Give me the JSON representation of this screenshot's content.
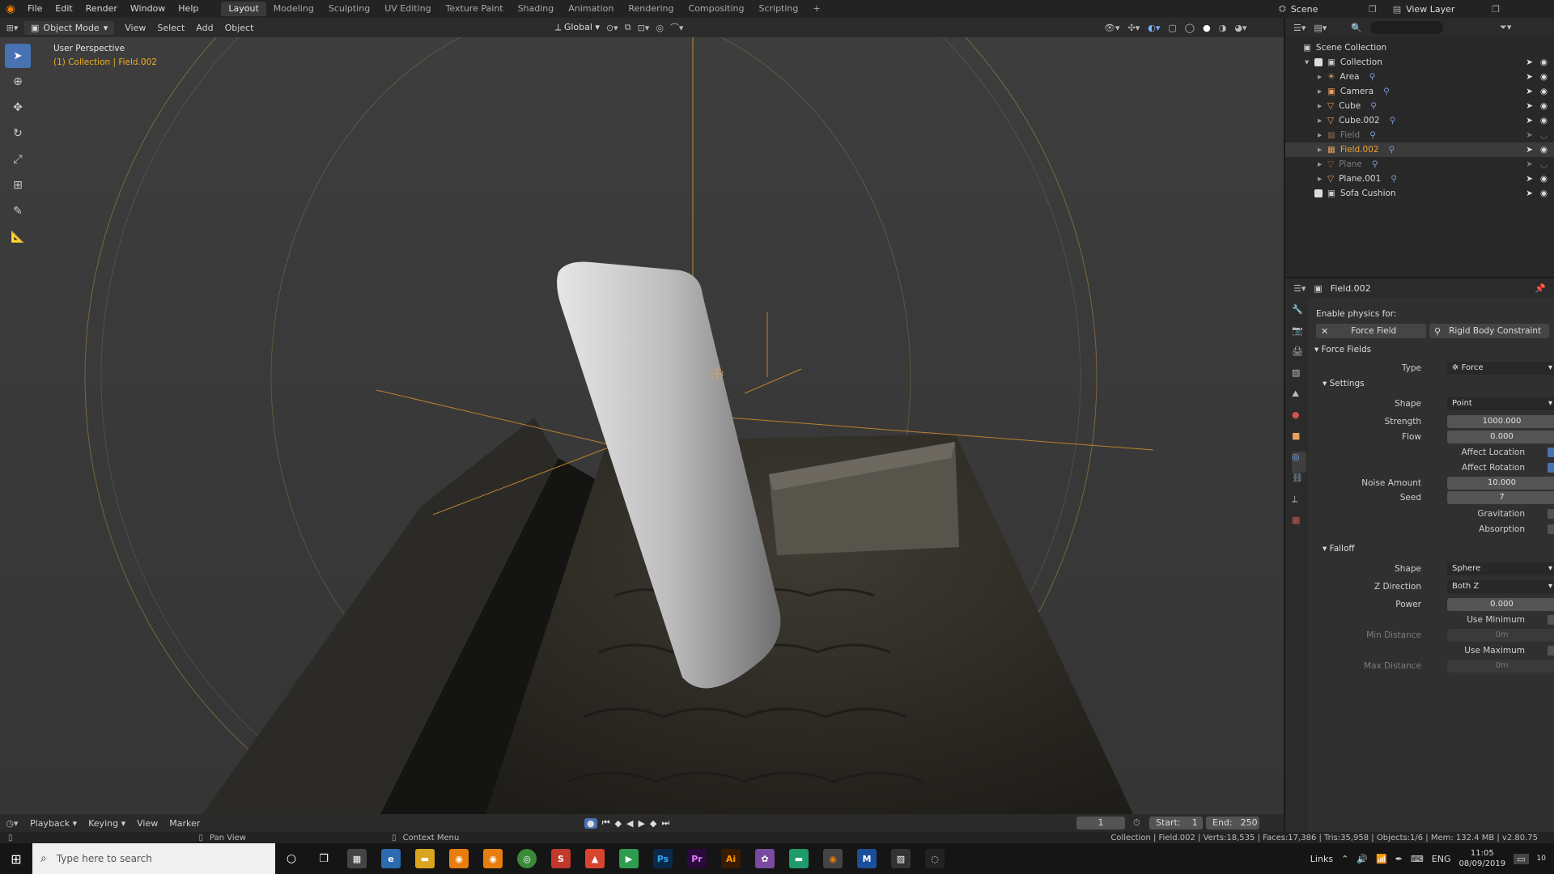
{
  "menu": {
    "items": [
      "File",
      "Edit",
      "Render",
      "Window",
      "Help"
    ]
  },
  "workspaces": {
    "active": "Layout",
    "tabs": [
      "Layout",
      "Modeling",
      "Sculpting",
      "UV Editing",
      "Texture Paint",
      "Shading",
      "Animation",
      "Rendering",
      "Compositing",
      "Scripting"
    ],
    "add": "+"
  },
  "top_right": {
    "scene": "Scene",
    "view_layer": "View Layer"
  },
  "viewport_header": {
    "mode": "Object Mode",
    "menus": [
      "View",
      "Select",
      "Add",
      "Object"
    ],
    "transform": "Global"
  },
  "viewport": {
    "perspective": "User Perspective",
    "collection_info": "(1) Collection | Field.002"
  },
  "outliner": {
    "root": "Scene Collection",
    "collection": "Collection",
    "items": [
      {
        "name": "Area",
        "icon": "light-icon",
        "dim": false,
        "highlight": false
      },
      {
        "name": "Camera",
        "icon": "camera-icon",
        "dim": false,
        "highlight": false
      },
      {
        "name": "Cube",
        "icon": "mesh-icon",
        "dim": false,
        "highlight": false
      },
      {
        "name": "Cube.002",
        "icon": "mesh-icon",
        "dim": false,
        "highlight": false
      },
      {
        "name": "Field",
        "icon": "field-icon",
        "dim": true,
        "highlight": false
      },
      {
        "name": "Field.002",
        "icon": "field-icon",
        "dim": false,
        "highlight": true
      },
      {
        "name": "Plane",
        "icon": "mesh-icon",
        "dim": true,
        "highlight": false
      },
      {
        "name": "Plane.001",
        "icon": "mesh-icon",
        "dim": false,
        "highlight": false
      }
    ],
    "extra": "Sofa Cushion"
  },
  "props": {
    "object": "Field.002",
    "enable_physics": "Enable physics for:",
    "force_field_btn": "Force Field",
    "rigid_body_btn": "Rigid Body Constraint",
    "force_fields": "Force Fields",
    "type_label": "Type",
    "type_value": "Force",
    "settings": "Settings",
    "shape_label": "Shape",
    "shape_value": "Point",
    "strength_label": "Strength",
    "strength_value": "1000.000",
    "flow_label": "Flow",
    "flow_value": "0.000",
    "affect_location": "Affect Location",
    "affect_rotation": "Affect Rotation",
    "noise_label": "Noise Amount",
    "noise_value": "10.000",
    "seed_label": "Seed",
    "seed_value": "7",
    "gravitation": "Gravitation",
    "absorption": "Absorption",
    "falloff": "Falloff",
    "f_shape_label": "Shape",
    "f_shape_value": "Sphere",
    "zdir_label": "Z Direction",
    "zdir_value": "Both Z",
    "power_label": "Power",
    "power_value": "0.000",
    "use_min": "Use Minimum",
    "min_dist_label": "Min Distance",
    "min_dist_value": "0m",
    "use_max": "Use Maximum",
    "max_dist_label": "Max Distance",
    "max_dist_value": "0m"
  },
  "timeline": {
    "menus": [
      "Playback",
      "Keying",
      "View",
      "Marker"
    ],
    "frame": "1",
    "start_label": "Start:",
    "start": "1",
    "end_label": "End:",
    "end": "250"
  },
  "status": {
    "pan": "Pan View",
    "context": "Context Menu",
    "stats": "Collection | Field.002 | Verts:18,535 | Faces:17,386 | Tris:35,958 | Objects:1/6 | Mem: 132.4 MB | v2.80.75"
  },
  "taskbar": {
    "search_placeholder": "Type here to search",
    "links": "Links",
    "lang": "ENG",
    "time": "11:05",
    "date": "08/09/2019",
    "notif": "10"
  },
  "colors": {
    "accent": "#4772b3",
    "selected_text": "#f0a030",
    "orange_lines": "#c98a2c"
  }
}
